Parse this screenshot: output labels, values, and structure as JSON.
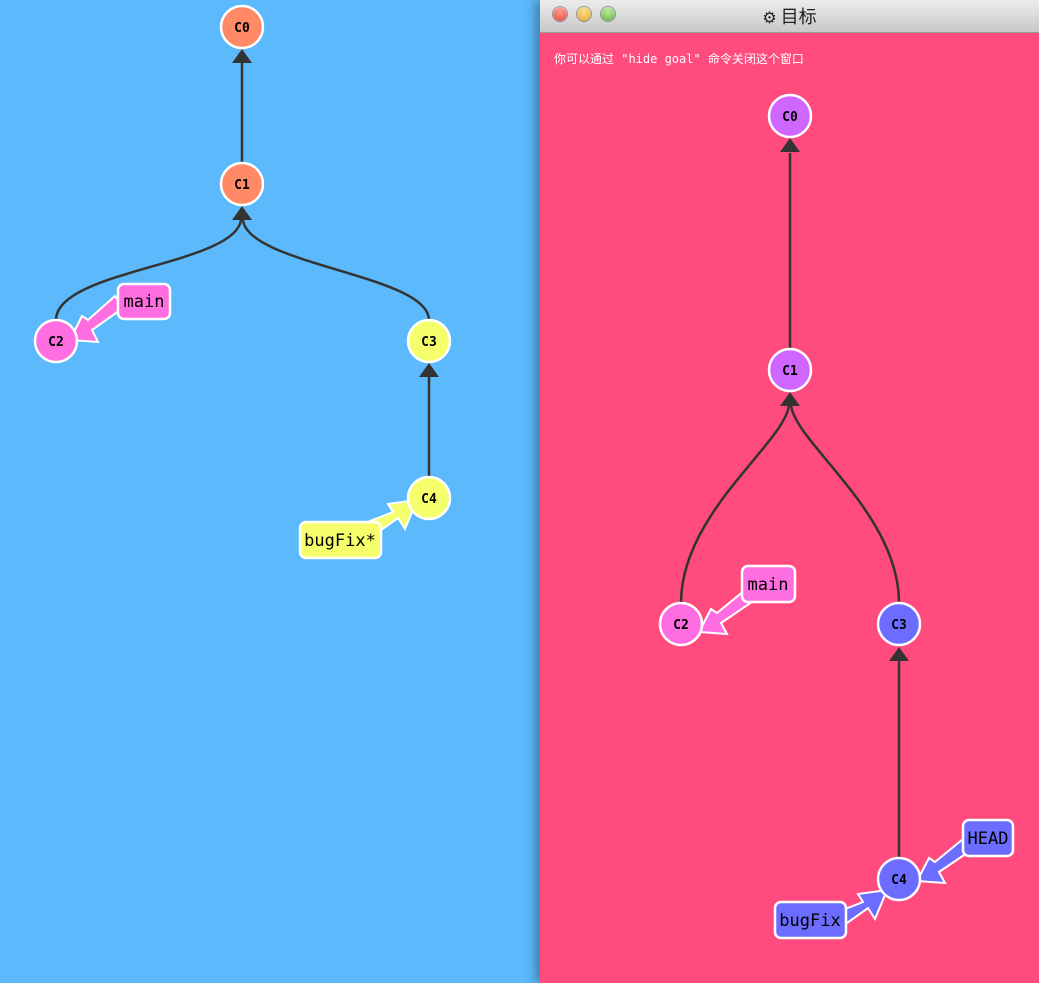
{
  "colors": {
    "left_background": "#5cb9fb",
    "goal_background": "#ff4b7d",
    "orange": "#ff8a65",
    "pink": "#ff6ee0",
    "yellow": "#f5ff6b",
    "purple": "#cf66ff",
    "blue": "#6c6cff",
    "edge": "#333333"
  },
  "current_tree": {
    "commits": [
      {
        "id": "C0",
        "color": "orange"
      },
      {
        "id": "C1",
        "color": "orange"
      },
      {
        "id": "C2",
        "color": "pink"
      },
      {
        "id": "C3",
        "color": "yellow"
      },
      {
        "id": "C4",
        "color": "yellow"
      }
    ],
    "branches": [
      {
        "label": "main",
        "target": "C2",
        "color": "pink"
      },
      {
        "label": "bugFix*",
        "target": "C4",
        "color": "yellow"
      }
    ]
  },
  "goal_window": {
    "title": "目标",
    "title_icon": "gear-icon",
    "hint": "你可以通过 \"hide goal\" 命令关闭这个窗口",
    "commits": [
      {
        "id": "C0",
        "color": "purple"
      },
      {
        "id": "C1",
        "color": "purple"
      },
      {
        "id": "C2",
        "color": "pink"
      },
      {
        "id": "C3",
        "color": "blue"
      },
      {
        "id": "C4",
        "color": "blue"
      }
    ],
    "branches": [
      {
        "label": "main",
        "target": "C2",
        "color": "pink"
      },
      {
        "label": "HEAD",
        "target": "C4",
        "color": "blue"
      },
      {
        "label": "bugFix",
        "target": "C4",
        "color": "blue"
      }
    ]
  }
}
